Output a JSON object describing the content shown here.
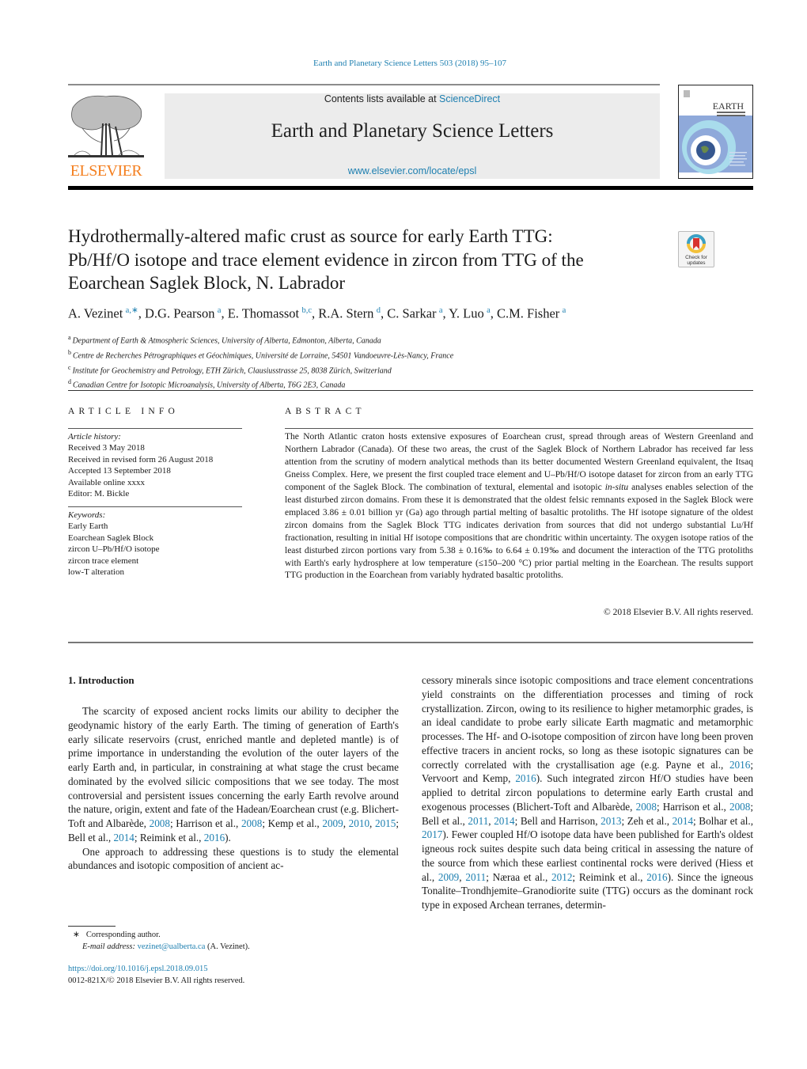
{
  "header": {
    "journal_ref": "Earth and Planetary Science Letters 503 (2018) 95–107",
    "contents_prefix": "Contents lists available at ",
    "contents_link": "ScienceDirect",
    "journal_title": "Earth and Planetary Science Letters",
    "journal_url": "www.elsevier.com/locate/epsl",
    "publisher_logo_text": "ELSEVIER",
    "cover_title": "EARTH",
    "cover_subtitle": "& PLANETARY SCIENCE LETTERS",
    "check_updates_label_1": "Check for",
    "check_updates_label_2": "updates"
  },
  "colors": {
    "link": "#1d7fb0",
    "elsevier_orange": "#f47f1f",
    "masthead_bg": "#ececec"
  },
  "article": {
    "title_lines": [
      "Hydrothermally-altered mafic crust as source for early Earth TTG:",
      "Pb/Hf/O isotope and trace element evidence in zircon from TTG of the",
      "Eoarchean Saglek Block, N. Labrador"
    ],
    "authors": [
      {
        "name": "A. Vezinet",
        "aff": "a,∗"
      },
      {
        "name": "D.G. Pearson",
        "aff": "a"
      },
      {
        "name": "E. Thomassot",
        "aff": "b,c"
      },
      {
        "name": "R.A. Stern",
        "aff": "d"
      },
      {
        "name": "C. Sarkar",
        "aff": "a"
      },
      {
        "name": "Y. Luo",
        "aff": "a"
      },
      {
        "name": "C.M. Fisher",
        "aff": "a"
      }
    ],
    "affiliations": [
      {
        "key": "a",
        "text": "Department of Earth & Atmospheric Sciences, University of Alberta, Edmonton, Alberta, Canada"
      },
      {
        "key": "b",
        "text": "Centre de Recherches Pétrographiques et Géochimiques, Université de Lorraine, 54501 Vandoeuvre-Lès-Nancy, France"
      },
      {
        "key": "c",
        "text": "Institute for Geochemistry and Petrology, ETH Zürich, Clausiusstrasse 25, 8038 Zürich, Switzerland"
      },
      {
        "key": "d",
        "text": "Canadian Centre for Isotopic Microanalysis, University of Alberta, T6G 2E3, Canada"
      }
    ]
  },
  "article_info": {
    "heading": "ARTICLE INFO",
    "history_label": "Article history:",
    "history": [
      "Received 3 May 2018",
      "Received in revised form 26 August 2018",
      "Accepted 13 September 2018",
      "Available online xxxx",
      "Editor: M. Bickle"
    ],
    "keywords_label": "Keywords:",
    "keywords": [
      "Early Earth",
      "Eoarchean Saglek Block",
      "zircon U–Pb/Hf/O isotope",
      "zircon trace element",
      "low-T alteration"
    ]
  },
  "abstract": {
    "heading": "ABSTRACT",
    "text_1": "The North Atlantic craton hosts extensive exposures of Eoarchean crust, spread through areas of Western Greenland and Northern Labrador (Canada). Of these two areas, the crust of the Saglek Block of Northern Labrador has received far less attention from the scrutiny of modern analytical methods than its better documented Western Greenland equivalent, the Itsaq Gneiss Complex. Here, we present the first coupled trace element and U–Pb/Hf/O isotope dataset for zircon from an early TTG component of the Saglek Block. The combination of textural, elemental and isotopic ",
    "text_italic": "in-situ",
    "text_2": " analyses enables selection of the least disturbed zircon domains. From these it is demonstrated that the oldest felsic remnants exposed in the Saglek Block were emplaced 3.86 ± 0.01 billion yr (Ga) ago through partial melting of basaltic protoliths. The Hf isotope signature of the oldest zircon domains from the Saglek Block TTG indicates derivation from sources that did not undergo substantial Lu/Hf fractionation, resulting in initial Hf isotope compositions that are chondritic within uncertainty. The oxygen isotope ratios of the least disturbed zircon portions vary from 5.38 ± 0.16‰ to 6.64 ± 0.19‰ and document the interaction of the TTG protoliths with Earth's early hydrosphere at low temperature (≤150–200 °C) prior partial melting in the Eoarchean. The results support TTG production in the Eoarchean from variably hydrated basaltic protoliths.",
    "copyright": "© 2018 Elsevier B.V. All rights reserved."
  },
  "introduction": {
    "heading": "1. Introduction",
    "left_p1_a": "The scarcity of exposed ancient rocks limits our ability to decipher the geodynamic history of the early Earth. The timing of generation of Earth's early silicate reservoirs (crust, enriched mantle and depleted mantle) is of prime importance in understanding the evolution of the outer layers of the early Earth and, in particular, in constraining at what stage the crust became dominated by the evolved silicic compositions that we see today. The most controversial and persistent issues concerning the early Earth revolve around the nature, origin, extent and fate of the Hadean/Eoarchean crust (e.g. Blichert-Toft and Albarède, ",
    "cites_left": [
      "2008",
      "2008",
      "2009",
      "2010",
      "2015",
      "2014",
      "2016"
    ],
    "left_sep": [
      "; Harrison et al., ",
      ";\nKemp et al., ",
      ", ",
      ", ",
      "; Bell et al., ",
      "; Reimink et al., ",
      ")."
    ],
    "left_p2": "One approach to addressing these questions is to study the elemental abundances and isotopic composition of ancient ac-",
    "right_p1_a": "cessory minerals since isotopic compositions and trace element concentrations yield constraints on the differentiation processes and timing of rock crystallization. Zircon, owing to its resilience to higher metamorphic grades, is an ideal candidate to probe early silicate Earth magmatic and metamorphic processes. The Hf- and O-isotope composition of zircon have long been proven effective tracers in ancient rocks, so long as these isotopic signatures can be correctly correlated with the crystallisation age (e.g. Payne et al., ",
    "cites_right": [
      "2016",
      "2016",
      "2008",
      "2008",
      "2011",
      "2014",
      "2013",
      "2014",
      "2017",
      "2009",
      "2011",
      "2012",
      "2016"
    ],
    "right_sep": [
      "; Vervoort and Kemp, ",
      "). Such integrated zircon Hf/O studies have been applied to detrital zircon populations to determine early Earth crustal and exogenous processes (Blichert-Toft and Albarède, ",
      "; Harrison et al., ",
      "; Bell et al., ",
      ", ",
      "; Bell and Harrison, ",
      "; Zeh et al., ",
      "; Bolhar et al., ",
      "). Fewer coupled Hf/O isotope data have been published for Earth's oldest igneous rock suites despite such data being critical in assessing the nature of the source from which these earliest continental rocks were derived (Hiess et al., ",
      ", ",
      "; Næraa et al., ",
      "; Reimink et al., ",
      "). Since the igneous Tonalite–Trondhjemite–Granodiorite suite (TTG) occurs as the dominant rock type in exposed Archean terranes, determin-"
    ]
  },
  "footnote": {
    "marker": "∗",
    "text": "Corresponding author.",
    "email_label": "E-mail address:",
    "email": "vezinet@ualberta.ca",
    "email_suffix": " (A. Vezinet)."
  },
  "doi": {
    "url": "https://doi.org/10.1016/j.epsl.2018.09.015",
    "issn_line": "0012-821X/© 2018 Elsevier B.V. All rights reserved."
  }
}
